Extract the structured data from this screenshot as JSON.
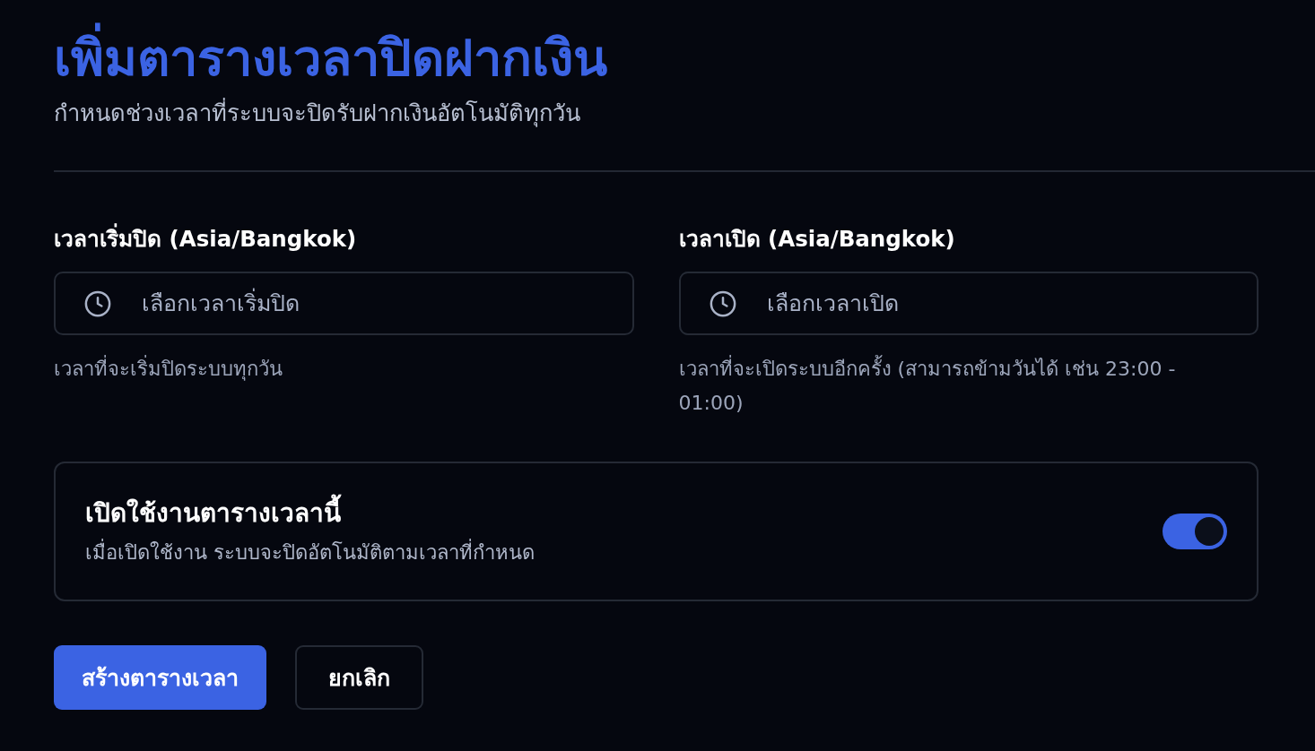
{
  "header": {
    "title": "เพิ่มตารางเวลาปิดฝากเงิน",
    "subtitle": "กำหนดช่วงเวลาที่ระบบจะปิดรับฝากเงินอัตโนมัติทุกวัน"
  },
  "fields": [
    {
      "label": "เวลาเริ่มปิด (Asia/Bangkok)",
      "placeholder": "เลือกเวลาเริ่มปิด",
      "hint": "เวลาที่จะเริ่มปิดระบบทุกวัน"
    },
    {
      "label": "เวลาเปิด (Asia/Bangkok)",
      "placeholder": "เลือกเวลาเปิด",
      "hint": "เวลาที่จะเปิดระบบอีกครั้ง (สามารถข้ามวันได้ เช่น 23:00 - 01:00)"
    }
  ],
  "toggle_card": {
    "title": "เปิดใช้งานตารางเวลานี้",
    "description": "เมื่อเปิดใช้งาน ระบบจะปิดอัตโนมัติตามเวลาที่กำหนด",
    "on": true
  },
  "buttons": [
    {
      "label": "สร้างตารางเวลา",
      "kind": "primary"
    },
    {
      "label": "ยกเลิก",
      "kind": "secondary"
    }
  ]
}
